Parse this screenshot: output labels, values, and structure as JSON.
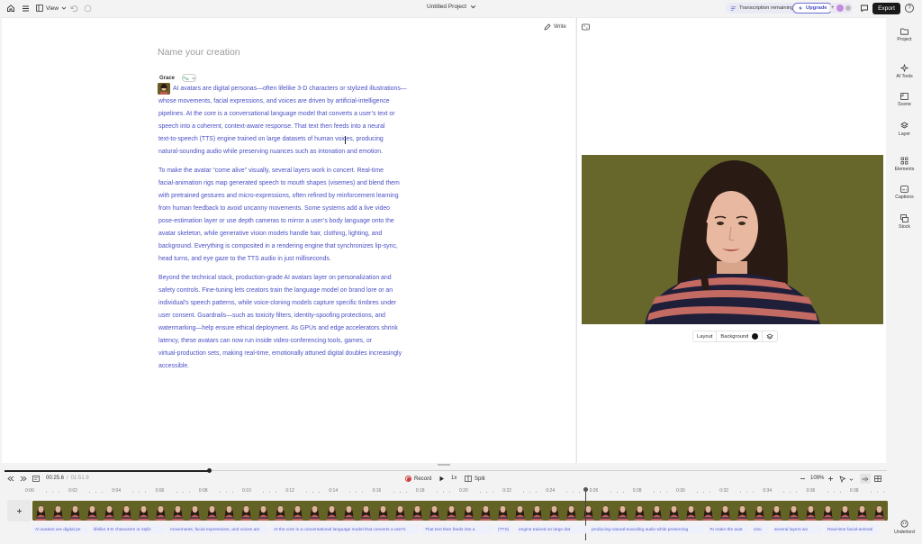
{
  "topbar": {
    "view_label": "View",
    "project_title": "Untitled Project",
    "transcription_label": "Transcription remaining",
    "upgrade_label": "Upgrade",
    "collab_count": "+",
    "export_label": "Export",
    "help_label": "?"
  },
  "editor": {
    "write_label": "Write",
    "title_placeholder": "Name your creation",
    "speaker_name": "Grace",
    "paragraphs": [
      [
        "AI avatars are digital personas—often lifelike 3-D characters or stylized illustrations—",
        "whose movements, facial expressions, and voices are driven by artificial-intelligence",
        "pipelines. At the core is a conversational language model that converts a user’s text or",
        "speech into a coherent, context-aware response. That text then feeds into a neural",
        "text-to-speech (TTS) engine trained on large datasets of human voices, producing",
        "natural-sounding audio while preserving nuances such as intonation and emotion."
      ],
      [
        "To make the avatar “come alive” visually, several layers work in concert. Real-time",
        "facial-animation rigs map generated speech to mouth shapes (visemes) and blend them",
        "with pretrained gestures and micro-expressions, often refined by reinforcement learning",
        "from human feedback to avoid uncanny movements. Some systems add a live video",
        "pose-estimation layer or use depth cameras to mirror a user’s body language onto the",
        "avatar skeleton, while generative vision models handle hair, clothing, lighting, and",
        "background. Everything is composited in a rendering engine that synchronizes lip-sync,",
        "head turns, and eye gaze to the TTS audio in just milliseconds."
      ],
      [
        "Beyond the technical stack, production-grade AI avatars layer on personalization and",
        "safety controls. Fine-tuning lets creators train the language model on brand lore or an",
        "individual’s speech patterns, while voice-cloning models capture specific timbres under",
        "user consent. Guardrails—such as toxicity filters, identity-spoofing protections, and",
        "watermarking—help ensure ethical deployment. As GPUs and edge accelerators shrink",
        "latency, these avatars can now run inside video-conferencing tools, games, or",
        "virtual-production sets, making real-time, emotionally attuned digital doubles increasingly",
        "accessible."
      ]
    ]
  },
  "preview": {
    "layout_label": "Layout",
    "background_label": "Background",
    "background_color": "#111111"
  },
  "sidebar": {
    "items": [
      "Project",
      "AI Tools",
      "Scene",
      "Layer",
      "Elements",
      "Captions",
      "Stock"
    ],
    "bottom_item": "Underlord"
  },
  "timeline": {
    "current_time": "00:25.6",
    "separator": "/",
    "total_time": "01:51.9",
    "record_label": "Record",
    "speed_label": "1x",
    "split_label": "Split",
    "zoom_label": "109%",
    "progress": 0.232,
    "ticks": [
      "0:00",
      "0:02",
      "0:04",
      "0:06",
      "0:08",
      "0:10",
      "0:12",
      "0:14",
      "0:16",
      "0:18",
      "0:20",
      "0:22",
      "0:24",
      "0:26",
      "0:28",
      "0:30",
      "0:32",
      "0:34",
      "0:36",
      "0:38"
    ],
    "captions": [
      "AI avatars are digital pe",
      "lifelike 3-D characters or styliz",
      "movements, facial expressions, and voices are",
      "At the core is a conversational language model that converts a user's",
      "That text then feeds into a",
      "(TTS)",
      "engine trained on large dat",
      "producing natural-sounding audio while preserving",
      "To make the avat",
      "visu",
      "several layers wo",
      "Real-time facial-animati"
    ]
  }
}
